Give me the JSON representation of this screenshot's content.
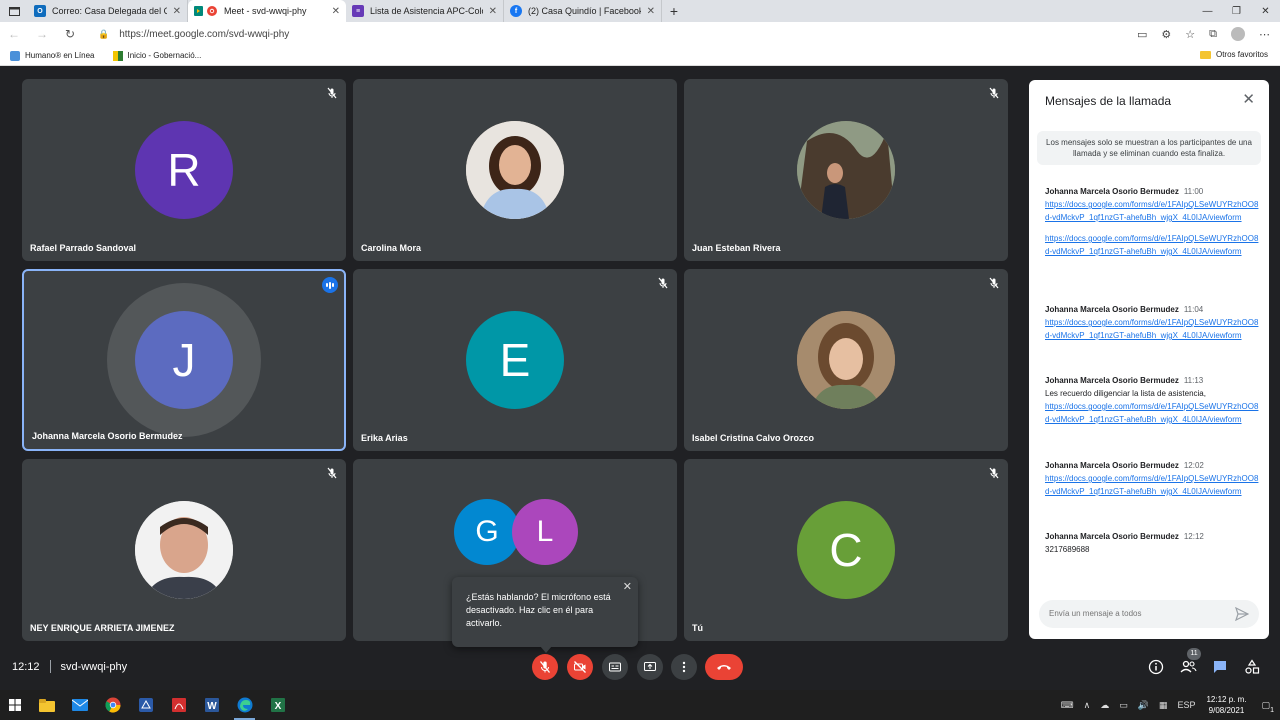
{
  "browser": {
    "tabs": [
      {
        "title": "Correo: Casa Delegada del Quin",
        "fav_color": "#0f6cbd",
        "fav_glyph": "O"
      },
      {
        "title": "Meet - svd-wwqi-phy",
        "fav_color": "#00897b",
        "fav_glyph": "M",
        "active": true
      },
      {
        "title": "Lista de Asistencia APC-Colombi",
        "fav_color": "#673ab7",
        "fav_glyph": "≡"
      },
      {
        "title": "(2) Casa Quindío | Facebook",
        "fav_color": "#1877f2",
        "fav_glyph": "f"
      }
    ],
    "url": "https://meet.google.com/svd-wwqi-phy",
    "bookmarks": [
      {
        "label": "Humano® en Línea"
      },
      {
        "label": "Inicio - Gobernació..."
      }
    ],
    "bookmarks_right": "Otros favoritos"
  },
  "participants": [
    {
      "name": "Rafael Parrado Sandoval",
      "initial": "R",
      "color": "#5e35b1",
      "muted": true
    },
    {
      "name": "Carolina Mora",
      "photo": true,
      "muted": false
    },
    {
      "name": "Juan Esteban Rivera",
      "photo": true,
      "muted": true
    },
    {
      "name": "Johanna Marcela Osorio Bermudez",
      "initial": "J",
      "color": "#5c6bc0",
      "speaking": true
    },
    {
      "name": "Erika Arias",
      "initial": "E",
      "color": "#0097a7",
      "muted": true
    },
    {
      "name": "Isabel Cristina Calvo Orozco",
      "photo": true,
      "muted": true
    },
    {
      "name": "NEY ENRIQUE ARRIETA JIMENEZ",
      "photo": true,
      "muted": true
    },
    {
      "name": "",
      "group": [
        {
          "initial": "G",
          "color": "#0288d1"
        },
        {
          "initial": "L",
          "color": "#ab47bc"
        }
      ]
    },
    {
      "name": "Tú",
      "initial": "C",
      "color": "#689f38",
      "muted": true
    }
  ],
  "tooltip": {
    "text": "¿Estás hablando? El micrófono está desactivado. Haz clic en él para activarlo."
  },
  "chat": {
    "title": "Mensajes de la llamada",
    "notice": "Los mensajes solo se muestran a los participantes de una llamada y se eliminan cuando esta finaliza.",
    "messages": [
      {
        "sender": "Johanna Marcela Osorio Bermudez",
        "time": "11:00",
        "lines": [
          {
            "link": "https://docs.google.com/forms/d/e/1FAIpQLSeWUYRzhOO8d-vdMckvP_1qf1nzGT-ahefuBh_wjgX_4L0IJA/viewform"
          },
          {
            "link": "https://docs.google.com/forms/d/e/1FAIpQLSeWUYRzhOO8d-vdMckvP_1qf1nzGT-ahefuBh_wjgX_4L0IJA/viewform"
          }
        ]
      },
      {
        "sender": "Johanna Marcela Osorio Bermudez",
        "time": "11:04",
        "lines": [
          {
            "link": "https://docs.google.com/forms/d/e/1FAIpQLSeWUYRzhOO8d-vdMckvP_1qf1nzGT-ahefuBh_wjgX_4L0IJA/viewform"
          }
        ]
      },
      {
        "sender": "Johanna Marcela Osorio Bermudez",
        "time": "11:13",
        "lines": [
          {
            "text": "Les recuerdo diligenciar la lista de asistencia,"
          },
          {
            "link": "https://docs.google.com/forms/d/e/1FAIpQLSeWUYRzhOO8d-vdMckvP_1qf1nzGT-ahefuBh_wjgX_4L0IJA/viewform"
          }
        ]
      },
      {
        "sender": "Johanna Marcela Osorio Bermudez",
        "time": "12:02",
        "lines": [
          {
            "link": "https://docs.google.com/forms/d/e/1FAIpQLSeWUYRzhOO8d-vdMckvP_1qf1nzGT-ahefuBh_wjgX_4L0IJA/viewform"
          }
        ]
      },
      {
        "sender": "Johanna Marcela Osorio Bermudez",
        "time": "12:12",
        "lines": [
          {
            "text": "3217689688"
          }
        ]
      }
    ],
    "input_placeholder": "Envía un mensaje a todos"
  },
  "meeting": {
    "time": "12:12",
    "code": "svd-wwqi-phy",
    "participant_count": "11"
  },
  "taskbar": {
    "language": "ESP",
    "clock_time": "12:12 p. m.",
    "clock_date": "9/08/2021",
    "notification_count": "1"
  },
  "icons": [
    "mic-off-icon",
    "camera-off-icon",
    "captions-icon",
    "present-icon",
    "more-icon",
    "hangup-icon",
    "info-icon",
    "people-icon",
    "chat-icon",
    "activities-icon"
  ]
}
